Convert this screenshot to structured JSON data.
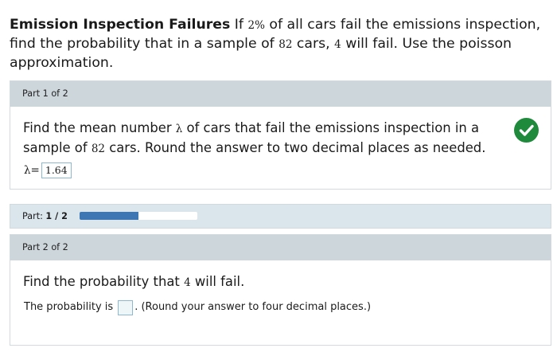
{
  "problem": {
    "title": "Emission Inspection Failures",
    "text_1": "If ",
    "percent": "2%",
    "text_2": " of all cars fail the emissions inspection, find the probability that in a sample of ",
    "sample_size": "82",
    "text_3": " cars, ",
    "fail_count": "4",
    "text_4": " will fail. Use the poisson approximation."
  },
  "part1": {
    "header": "Part 1 of 2",
    "status_icon": "check-icon",
    "status_color": "#1f8a3b",
    "question_1": "Find the mean number ",
    "lambda_symbol": "λ",
    "question_2": " of cars that fail the emissions inspection in a sample of ",
    "sample_size": "82",
    "question_3": " cars. Round the answer to two decimal places as needed.",
    "answer_label": "λ=",
    "answer_value": "1.64"
  },
  "progress": {
    "label": "Part:",
    "value_text": "1 / 2",
    "fraction": 0.5,
    "fill_color": "#3e76b4"
  },
  "part2": {
    "header": "Part 2 of 2",
    "question_1": "Find the probability that ",
    "fail_count": "4",
    "question_2": " will fail.",
    "answer_prefix": "The probability is",
    "answer_value": "",
    "answer_suffix": ". (Round your answer to four decimal places.)"
  }
}
